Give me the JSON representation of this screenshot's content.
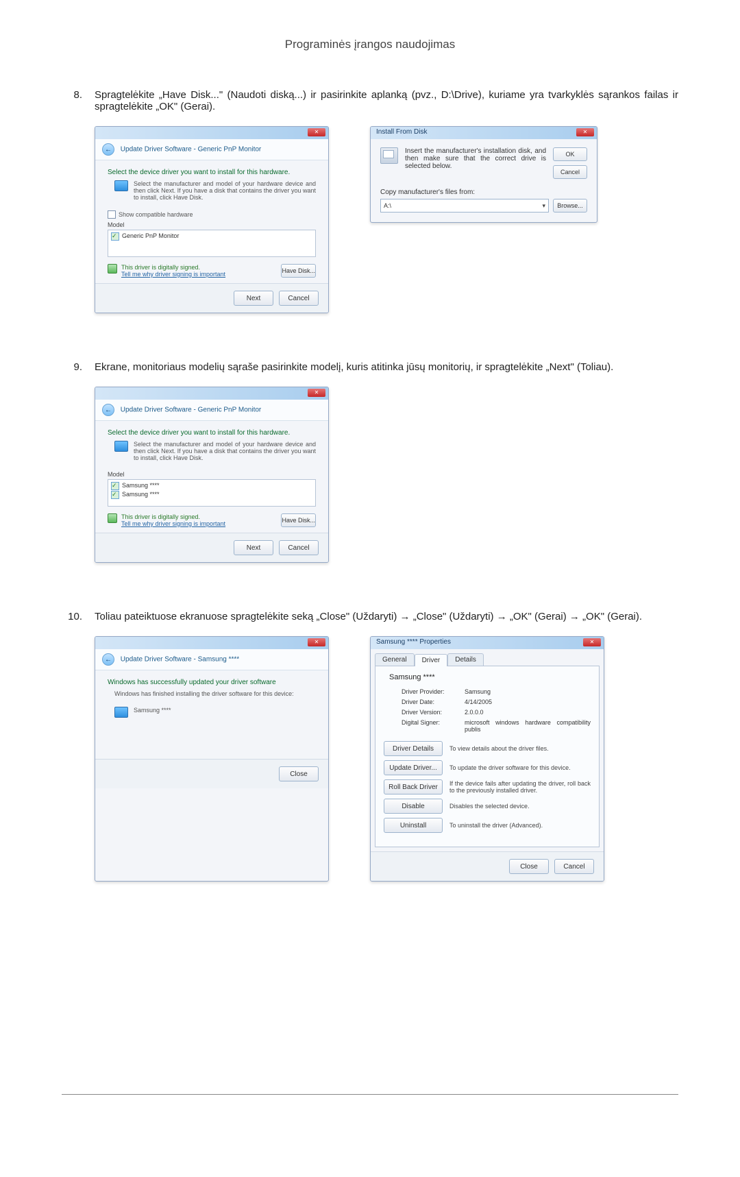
{
  "page_header": "Programinės įrangos naudojimas",
  "steps": {
    "s8": {
      "num": "8.",
      "text": "Spragtelėkite „Have Disk...\" (Naudoti diską...) ir pasirinkite aplanką (pvz., D:\\Drive), kuriame yra tvarkyklės sąrankos failas ir spragtelėkite „OK\" (Gerai)."
    },
    "s9": {
      "num": "9.",
      "text": "Ekrane, monitoriaus modelių sąraše pasirinkite modelį, kuris atitinka jūsų monitorių, ir spragtelėkite „Next\" (Toliau)."
    },
    "s10": {
      "num": "10.",
      "text": "Toliau pateiktuose ekranuose spragtelėkite seką „Close\" (Uždaryti) → „Close\" (Uždaryti) → „OK\" (Gerai) → „OK\" (Gerai)."
    }
  },
  "dlg1": {
    "crumb": "Update Driver Software - Generic PnP Monitor",
    "heading": "Select the device driver you want to install for this hardware.",
    "hint": "Select the manufacturer and model of your hardware device and then click Next. If you have a disk that contains the driver you want to install, click Have Disk.",
    "show_compatible": "Show compatible hardware",
    "model_hdr": "Model",
    "model_item": "Generic PnP Monitor",
    "signed": "This driver is digitally signed.",
    "signed_link": "Tell me why driver signing is important",
    "have_disk": "Have Disk...",
    "next": "Next",
    "cancel": "Cancel"
  },
  "dlg2": {
    "title": "Install From Disk",
    "msg": "Insert the manufacturer's installation disk, and then make sure that the correct drive is selected below.",
    "ok": "OK",
    "cancel": "Cancel",
    "copy_label": "Copy manufacturer's files from:",
    "combo_value": "A:\\",
    "browse": "Browse..."
  },
  "dlg3": {
    "crumb": "Update Driver Software - Generic PnP Monitor",
    "heading": "Select the device driver you want to install for this hardware.",
    "hint": "Select the manufacturer and model of your hardware device and then click Next. If you have a disk that contains the driver you want to install, click Have Disk.",
    "model_hdr": "Model",
    "items": [
      "Samsung ****",
      "Samsung ****"
    ],
    "signed": "This driver is digitally signed.",
    "signed_link": "Tell me why driver signing is important",
    "have_disk": "Have Disk...",
    "next": "Next",
    "cancel": "Cancel"
  },
  "dlg4": {
    "crumb": "Update Driver Software - Samsung ****",
    "heading": "Windows has successfully updated your driver software",
    "sub": "Windows has finished installing the driver software for this device:",
    "item": "Samsung ****",
    "close": "Close"
  },
  "dlg5": {
    "title": "Samsung **** Properties",
    "tabs": {
      "general": "General",
      "driver": "Driver",
      "details": "Details"
    },
    "headline": "Samsung ****",
    "kv": {
      "provider_k": "Driver Provider:",
      "provider_v": "Samsung",
      "date_k": "Driver Date:",
      "date_v": "4/14/2005",
      "ver_k": "Driver Version:",
      "ver_v": "2.0.0.0",
      "signer_k": "Digital Signer:",
      "signer_v": "microsoft windows hardware compatibility publis"
    },
    "actions": {
      "details_btn": "Driver Details",
      "details_txt": "To view details about the driver files.",
      "update_btn": "Update Driver...",
      "update_txt": "To update the driver software for this device.",
      "roll_btn": "Roll Back Driver",
      "roll_txt": "If the device fails after updating the driver, roll back to the previously installed driver.",
      "disable_btn": "Disable",
      "disable_txt": "Disables the selected device.",
      "uninst_btn": "Uninstall",
      "uninst_txt": "To uninstall the driver (Advanced)."
    },
    "close": "Close",
    "cancel": "Cancel"
  }
}
